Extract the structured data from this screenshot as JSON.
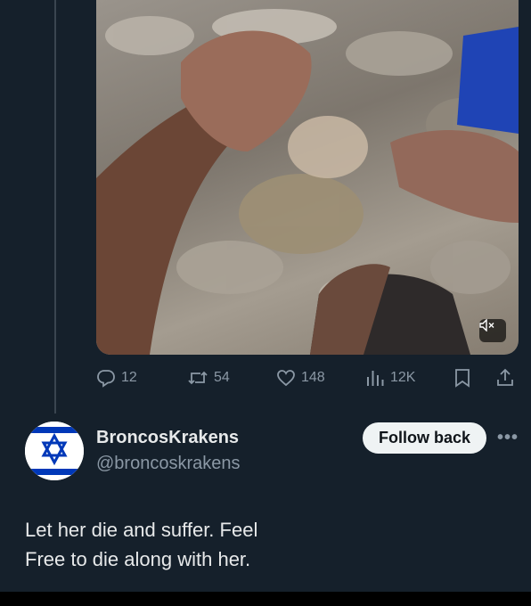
{
  "media": {
    "kind": "video",
    "mute_icon": "speaker-muted-icon"
  },
  "actions": {
    "replies": "12",
    "reposts": "54",
    "likes": "148",
    "views": "12K",
    "icons": [
      "reply-icon",
      "repost-icon",
      "like-icon",
      "views-icon",
      "bookmark-icon",
      "share-icon"
    ]
  },
  "next_tweet": {
    "display_name": "BroncosKrakens",
    "handle": "@broncoskrakens",
    "follow_label": "Follow back",
    "more_label": "•••",
    "text_lines": [
      "Let her die and suffer. Feel",
      "Free to die along with her."
    ],
    "avatar_icon": "star-of-david-flag-icon"
  },
  "colors": {
    "background": "#15202b",
    "text_primary": "#e7e9ea",
    "text_secondary": "#8b98a5",
    "follow_button_bg": "#eff3f4",
    "flag_blue": "#0038b8"
  }
}
